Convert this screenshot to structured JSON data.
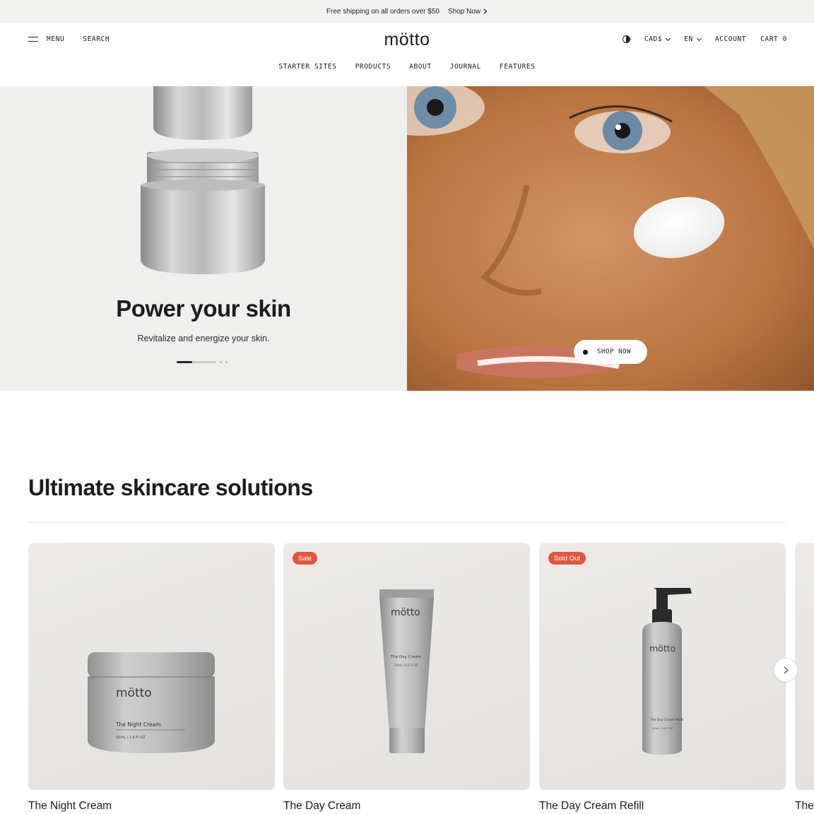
{
  "announcement": {
    "text": "Free shipping on all orders over $50",
    "link": "Shop Now"
  },
  "header": {
    "menu_label": "MENU",
    "search_label": "SEARCH",
    "logo": "mötto",
    "currency": "CAD$",
    "language": "EN",
    "account_label": "ACCOUNT",
    "cart_label": "CART 0"
  },
  "nav": [
    "STARTER SITES",
    "PRODUCTS",
    "ABOUT",
    "JOURNAL",
    "FEATURES"
  ],
  "hero": {
    "title": "Power your skin",
    "subtitle": "Revitalize and energize your skin.",
    "cta": "SHOP NOW",
    "slide_progress": 0.4,
    "slides_total": 3
  },
  "collection": {
    "title": "Ultimate skincare solutions",
    "products": [
      {
        "name": "The Night Cream",
        "badge": "",
        "brand": "mötto",
        "label": "The Night Cream",
        "size": "50mL / 1.6 Fl OZ"
      },
      {
        "name": "The Day Cream",
        "badge": "Sale",
        "brand": "mötto",
        "label": "The Day Cream",
        "size": "10mL / 0.3 Fl OZ"
      },
      {
        "name": "The Day Cream Refill",
        "badge": "Sold Out",
        "brand": "mötto",
        "label": "The Day Cream Refill",
        "size": "50mL / 1.6 Fl OZ"
      }
    ],
    "next_peek_name": "The"
  },
  "colors": {
    "badge": "#e2563d",
    "hero_left_bg": "#efefed",
    "card_bg": "#e8e7e4"
  }
}
